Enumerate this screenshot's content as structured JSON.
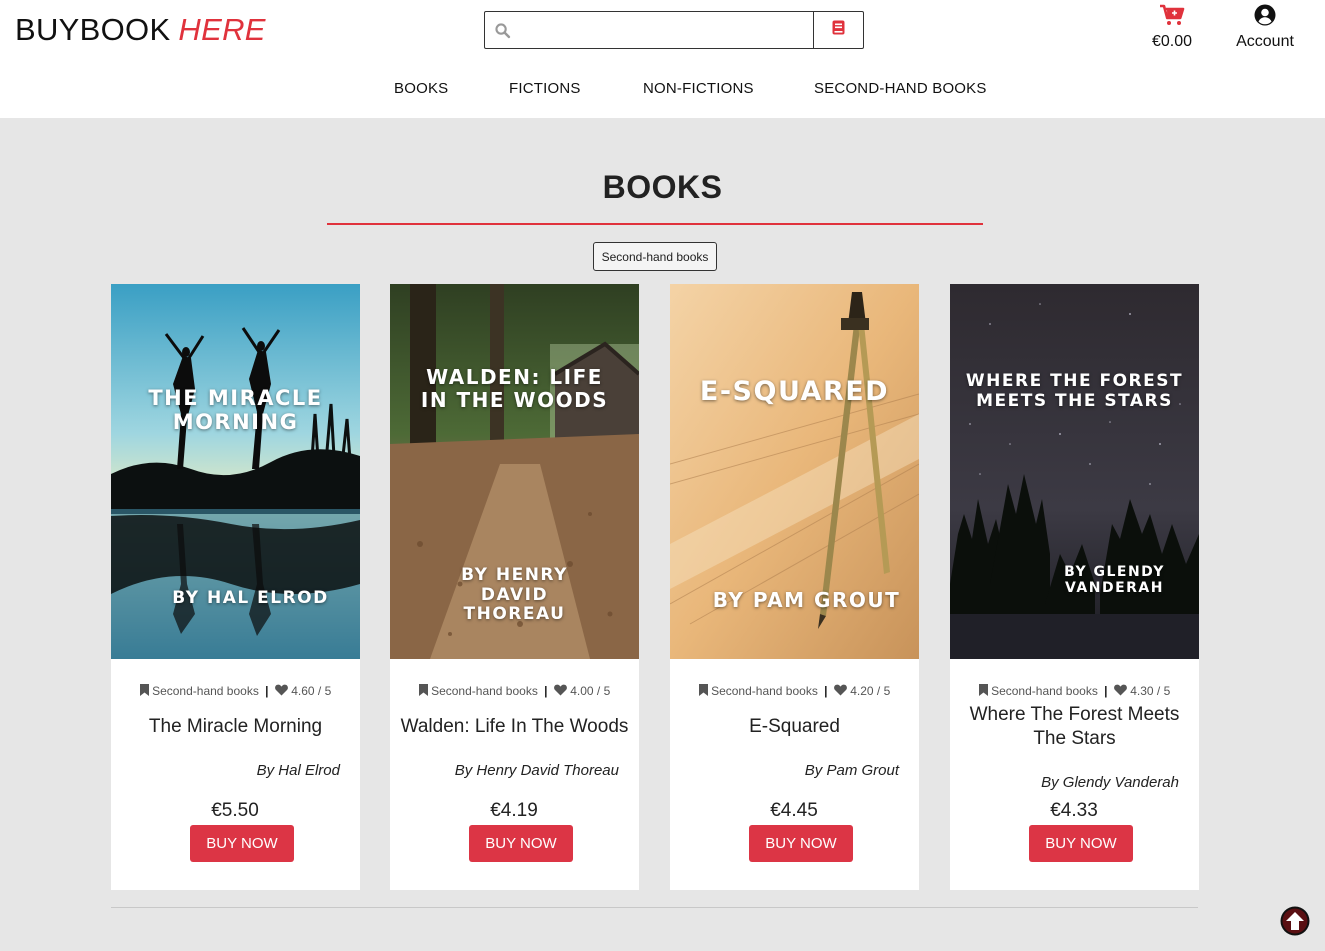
{
  "header": {
    "logo_main": "BUYBOOK",
    "logo_accent": "HERE",
    "search_placeholder": "",
    "cart_total": "€0.00",
    "account_label": "Account"
  },
  "nav": {
    "items": [
      "BOOKS",
      "FICTIONS",
      "NON-FICTIONS",
      "SECOND-HAND BOOKS"
    ]
  },
  "main": {
    "section_title": "BOOKS",
    "category_tag": "Second-hand books",
    "products": [
      {
        "category": "Second-hand books",
        "rating": "4.60 / 5",
        "title": "The Miracle Morning",
        "author": "By Hal Elrod",
        "price": "€5.50",
        "buy_label": "BUY NOW",
        "cover_title": "THE MIRACLE MORNING",
        "cover_author": "BY HAL ELROD"
      },
      {
        "category": "Second-hand books",
        "rating": "4.00 / 5",
        "title": "Walden: Life In The Woods",
        "author": "By Henry David Thoreau",
        "price": "€4.19",
        "buy_label": "BUY NOW",
        "cover_title": "WALDEN: LIFE IN THE WOODS",
        "cover_author": "BY HENRY DAVID THOREAU"
      },
      {
        "category": "Second-hand books",
        "rating": "4.20 / 5",
        "title": "E-Squared",
        "author": "By Pam Grout",
        "price": "€4.45",
        "buy_label": "BUY NOW",
        "cover_title": "E-SQUARED",
        "cover_author": "BY PAM GROUT"
      },
      {
        "category": "Second-hand books",
        "rating": "4.30 / 5",
        "title": "Where The Forest Meets The Stars",
        "author": "By Glendy Vanderah",
        "price": "€4.33",
        "buy_label": "BUY NOW",
        "cover_title": "WHERE THE FOREST MEETS THE STARS",
        "cover_author": "BY GLENDY VANDERAH"
      }
    ]
  },
  "colors": {
    "accent": "#e0323c",
    "button": "#dc3545",
    "background": "#e6e6e6"
  },
  "icons": {
    "search": "search-icon",
    "book": "book-icon",
    "cart": "cart-icon",
    "account": "user-circle-icon",
    "category": "bookmark-icon",
    "rating": "heart-icon",
    "back_to_top": "arrow-up-circle-icon"
  }
}
